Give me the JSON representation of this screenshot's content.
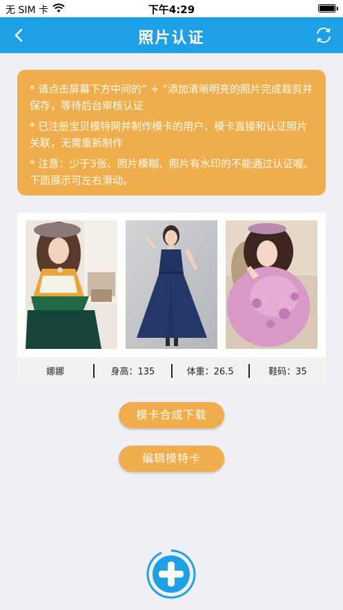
{
  "status_bar": {
    "carrier": "无 SIM 卡",
    "time": "下午4:29"
  },
  "nav": {
    "title": "照片认证"
  },
  "notice": {
    "lines": [
      "* 请点击屏幕下方中间的“ + ”添加清晰明亮的照片完成裁剪并保存，等待后台审核认证",
      "* 已注册宝贝模特网并制作模卡的用户，模卡直接和认证照片关联，无需重新制作",
      "* 注意：少于3张、照片模糊、照片有水印的不能通过认证喔。下面展示可左右滑动。"
    ]
  },
  "model_card": {
    "name": "娜娜",
    "height": "身高：135",
    "weight": "体重：26.5",
    "shoe": "鞋码：35"
  },
  "buttons": {
    "download_card": "模卡合成下载",
    "edit_card": "编辑模特卡"
  },
  "colors": {
    "nav_blue": "#1ea0e6",
    "accent_orange": "#f0ad4e",
    "background": "#efeff4"
  }
}
